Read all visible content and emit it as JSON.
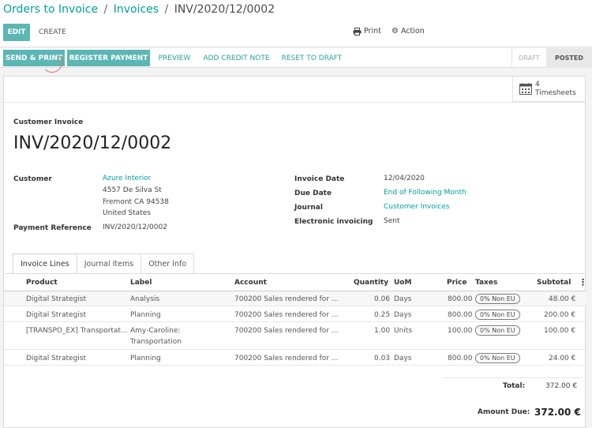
{
  "breadcrumb": {
    "parent1": "Orders to Invoice",
    "parent2": "Invoices",
    "current": "INV/2020/12/0002",
    "sep": "/"
  },
  "control": {
    "edit": "EDIT",
    "create": "CREATE",
    "print": "Print",
    "action": "Action"
  },
  "statusbar": {
    "send_print": "SEND & PRINT",
    "register_payment": "REGISTER PAYMENT",
    "preview": "PREVIEW",
    "add_credit_note": "ADD CREDIT NOTE",
    "reset_to_draft": "RESET TO DRAFT",
    "state_draft": "DRAFT",
    "state_posted": "POSTED"
  },
  "smart": {
    "count": "4",
    "label": "Timesheets",
    "icon": "calendar-icon"
  },
  "invoice": {
    "type_label": "Customer Invoice",
    "number": "INV/2020/12/0002",
    "customer_label": "Customer",
    "customer_name": "Azure Interior",
    "address_line1": "4557 De Silva St",
    "address_line2": "Fremont CA 94538",
    "address_line3": "United States",
    "payment_ref_label": "Payment Reference",
    "payment_ref": "INV/2020/12/0002",
    "invoice_date_label": "Invoice Date",
    "invoice_date": "12/04/2020",
    "due_date_label": "Due Date",
    "due_date": "End of Following Month",
    "journal_label": "Journal",
    "journal": "Customer Invoices",
    "einvoicing_label": "Electronic invoicing",
    "einvoicing": "Sent"
  },
  "tabs": [
    "Invoice Lines",
    "Journal Items",
    "Other Info"
  ],
  "table": {
    "headers": [
      "Product",
      "Label",
      "Account",
      "Quantity",
      "UoM",
      "Price",
      "Taxes",
      "Subtotal"
    ],
    "rows": [
      {
        "product": "Digital Strategist",
        "label": "Analysis",
        "label2": "",
        "account": "700200 Sales rendered for ...",
        "qty": "0.06",
        "uom": "Days",
        "price": "800.00",
        "tax": "0% Non EU",
        "subtotal": "48.00 €"
      },
      {
        "product": "Digital Strategist",
        "label": "Planning",
        "label2": "",
        "account": "700200 Sales rendered for ...",
        "qty": "0.25",
        "uom": "Days",
        "price": "800.00",
        "tax": "0% Non EU",
        "subtotal": "200.00 €"
      },
      {
        "product": "[TRANSPO_EX] Transportat...",
        "label": "Amy-Caroline:",
        "label2": "Transportation",
        "account": "700200 Sales rendered for ...",
        "qty": "1.00",
        "uom": "Units",
        "price": "100.00",
        "tax": "0% Non EU",
        "subtotal": "100.00 €"
      },
      {
        "product": "Digital Strategist",
        "label": "Planning",
        "label2": "",
        "account": "700200 Sales rendered for ...",
        "qty": "0.03",
        "uom": "Days",
        "price": "800.00",
        "tax": "0% Non EU",
        "subtotal": "24.00 €"
      }
    ]
  },
  "totals": {
    "total_label": "Total:",
    "total": "372.00 €",
    "amount_due_label": "Amount Due:",
    "amount_due": "372.00 €"
  },
  "colors": {
    "accent": "#00a09d",
    "button": "#5cb7b4"
  }
}
